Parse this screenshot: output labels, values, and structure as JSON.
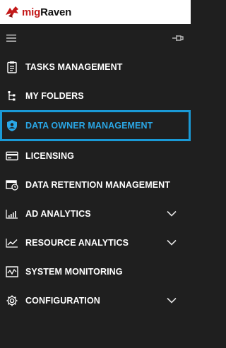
{
  "app": {
    "name_prefix": "mig",
    "name_suffix": "Raven",
    "logo_icon": "raven-logo-icon",
    "accent_color": "#1a9ad6",
    "brand_color": "#c41a1a"
  },
  "nav": {
    "menu_icon": "hamburger-icon",
    "pin_icon": "pin-icon",
    "items": [
      {
        "label": "TASKS MANAGEMENT",
        "icon": "clipboard-icon",
        "active": false,
        "expandable": false
      },
      {
        "label": "MY FOLDERS",
        "icon": "folder-tree-icon",
        "active": false,
        "expandable": false
      },
      {
        "label": "DATA OWNER MANAGEMENT",
        "icon": "shield-user-icon",
        "active": true,
        "expandable": false
      },
      {
        "label": "LICENSING",
        "icon": "card-icon",
        "active": false,
        "expandable": false
      },
      {
        "label": "DATA RETENTION MANAGEMENT",
        "icon": "archive-clock-icon",
        "active": false,
        "expandable": false
      },
      {
        "label": "AD ANALYTICS",
        "icon": "bar-chart-icon",
        "active": false,
        "expandable": true
      },
      {
        "label": "RESOURCE ANALYTICS",
        "icon": "line-chart-icon",
        "active": false,
        "expandable": true
      },
      {
        "label": "SYSTEM MONITORING",
        "icon": "monitor-pulse-icon",
        "active": false,
        "expandable": false
      },
      {
        "label": "CONFIGURATION",
        "icon": "gear-icon",
        "active": false,
        "expandable": true
      }
    ]
  }
}
